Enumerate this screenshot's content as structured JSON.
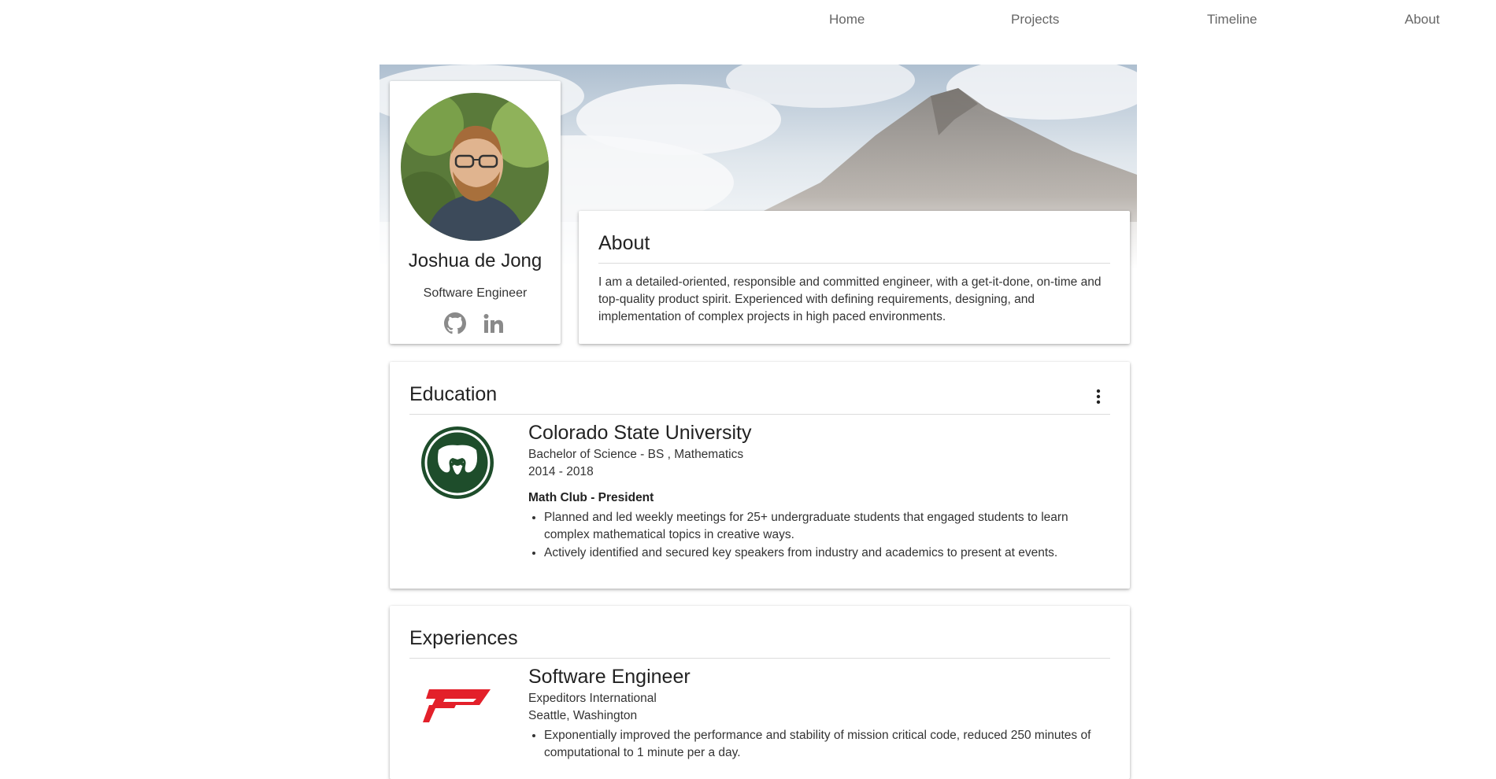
{
  "nav": {
    "items": [
      {
        "label": "Home"
      },
      {
        "label": "Projects"
      },
      {
        "label": "Timeline"
      },
      {
        "label": "About"
      }
    ]
  },
  "profile": {
    "name": "Joshua de Jong",
    "title": "Software Engineer",
    "social": [
      "github-icon",
      "linkedin-icon"
    ]
  },
  "about": {
    "title": "About",
    "text": "I am a detailed-oriented, responsible and committed engineer, with a get-it-done, on-time and top-quality product spirit. Experienced with defining requirements, designing, and implementation of complex projects in high paced environments."
  },
  "education": {
    "title": "Education",
    "school": "Colorado State University",
    "degree": "Bachelor of Science - BS , Mathematics",
    "years": "2014 - 2018",
    "activity": "Math Club - President",
    "bullets": [
      "Planned and led weekly meetings for 25+ undergraduate students that engaged students to learn complex mathematical topics in creative ways.",
      "Actively identified and secured key speakers from industry and academics to present at events."
    ],
    "logo_color": "#1e4d2b"
  },
  "experiences": {
    "title": "Experiences",
    "role": "Software Engineer",
    "company": "Expeditors International",
    "location": "Seattle, Washington",
    "bullets": [
      "Exponentially improved the performance and stability of mission critical code, reduced 250 minutes of computational to 1 minute per a day."
    ],
    "logo_color": "#e3202a"
  }
}
